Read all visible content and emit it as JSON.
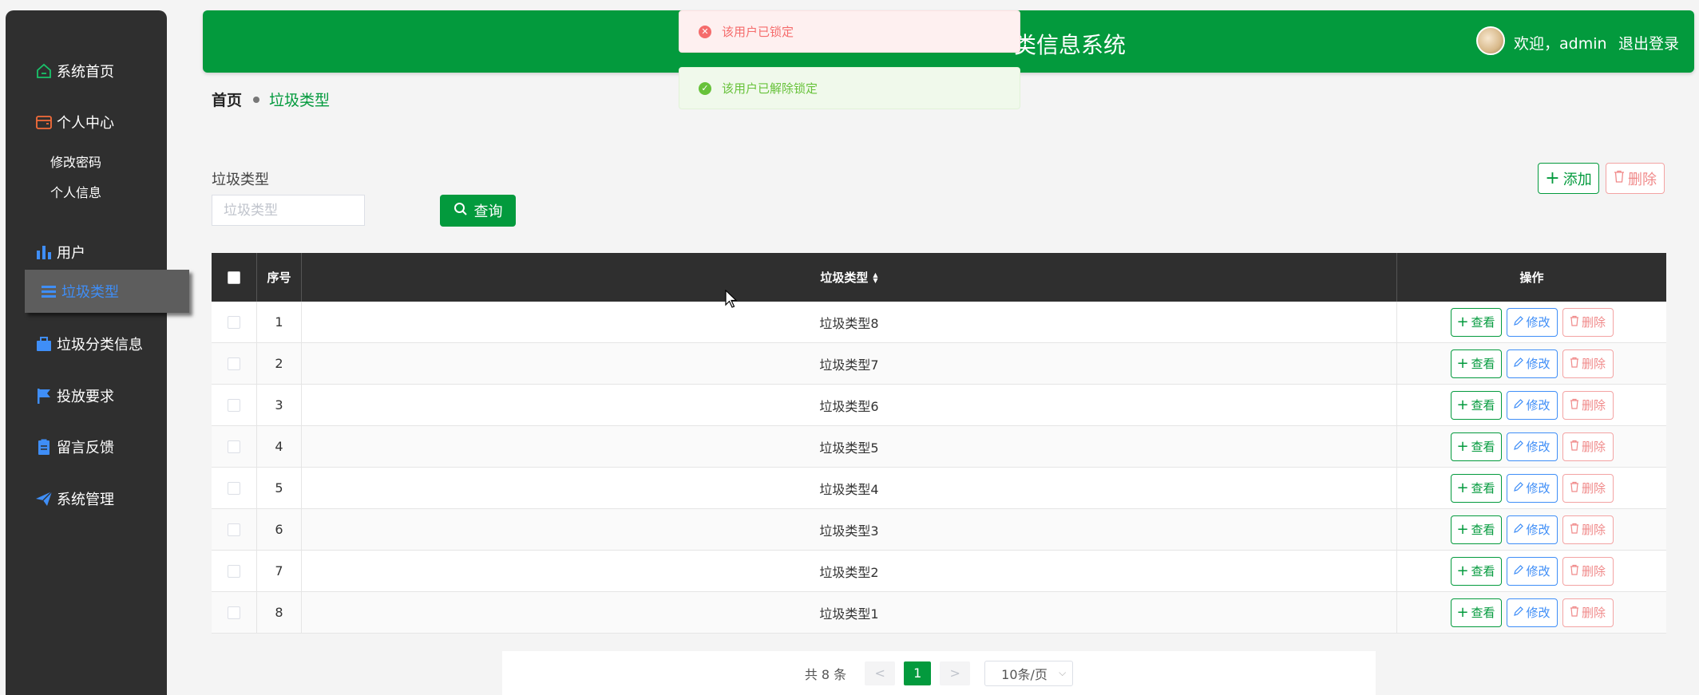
{
  "sidebar": {
    "items": [
      {
        "label": "系统首页",
        "icon": "home-icon"
      },
      {
        "label": "个人中心",
        "icon": "wallet-icon"
      },
      {
        "label": "用户",
        "icon": "bar-chart-icon"
      },
      {
        "label": "垃圾类型",
        "icon": "list-icon"
      },
      {
        "label": "垃圾分类信息",
        "icon": "briefcase-icon"
      },
      {
        "label": "投放要求",
        "icon": "flag-icon"
      },
      {
        "label": "留言反馈",
        "icon": "clipboard-icon"
      },
      {
        "label": "系统管理",
        "icon": "send-icon"
      }
    ],
    "subitems": [
      "修改密码",
      "个人信息"
    ]
  },
  "header": {
    "title": "类信息系统",
    "welcome": "欢迎，admin",
    "logout": "退出登录"
  },
  "toasts": {
    "error": "该用户已锁定",
    "success": "该用户已解除锁定"
  },
  "breadcrumb": {
    "home": "首页",
    "current": "垃圾类型"
  },
  "search": {
    "label": "垃圾类型",
    "placeholder": "垃圾类型",
    "button": "查询"
  },
  "toolbar": {
    "add": "添加",
    "delete": "删除"
  },
  "table": {
    "headers": {
      "index": "序号",
      "type": "垃圾类型",
      "ops": "操作"
    },
    "actions": {
      "view": "查看",
      "edit": "修改",
      "delete": "删除"
    },
    "rows": [
      {
        "index": "1",
        "type": "垃圾类型8"
      },
      {
        "index": "2",
        "type": "垃圾类型7"
      },
      {
        "index": "3",
        "type": "垃圾类型6"
      },
      {
        "index": "4",
        "type": "垃圾类型5"
      },
      {
        "index": "5",
        "type": "垃圾类型4"
      },
      {
        "index": "6",
        "type": "垃圾类型3"
      },
      {
        "index": "7",
        "type": "垃圾类型2"
      },
      {
        "index": "8",
        "type": "垃圾类型1"
      }
    ]
  },
  "pagination": {
    "total": "共 8 条",
    "prev": "<",
    "page": "1",
    "next": ">",
    "page_size": "10条/页"
  },
  "colors": {
    "brand": "#039a3d",
    "sidebar": "#2f2f2f",
    "edit": "#3f8ef7",
    "danger": "#f08a8a"
  }
}
